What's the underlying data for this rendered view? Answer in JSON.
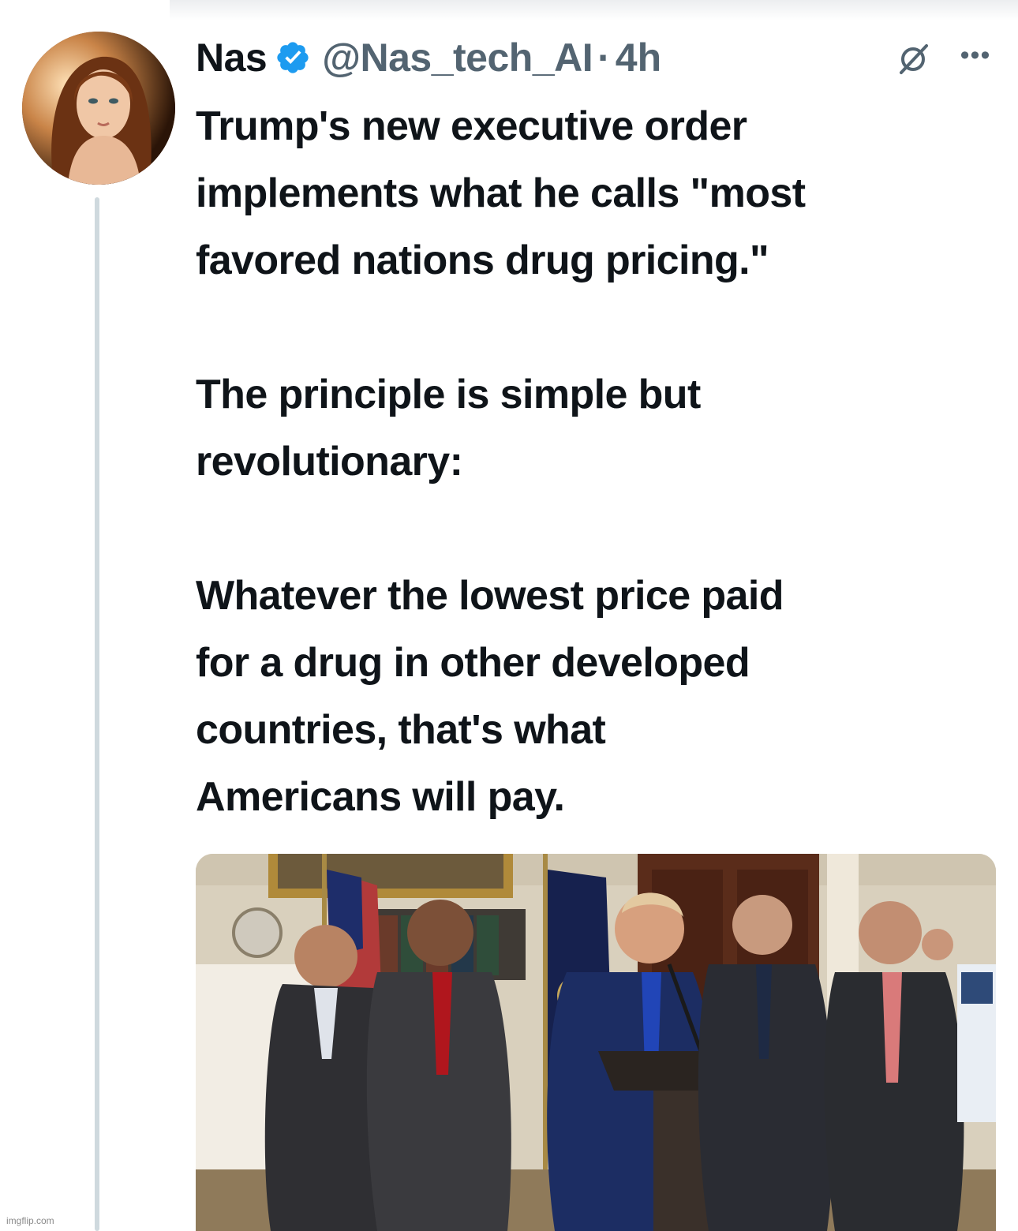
{
  "tweet": {
    "display_name": "Nas",
    "handle": "@Nas_tech_AI",
    "separator": "·",
    "timestamp": "4h",
    "verified": true,
    "paragraphs": [
      [
        "Trump's new executive order",
        "implements what he calls \"most",
        "favored nations drug pricing.\""
      ],
      [
        "The principle is simple but",
        "revolutionary:"
      ],
      [
        "Whatever the lowest price paid",
        "for a drug in other developed",
        "countries, that's what",
        "Americans will pay."
      ]
    ]
  },
  "icons": {
    "verified": "verified-badge-icon",
    "grok": "grok-icon",
    "more": "more-options-icon"
  },
  "colors": {
    "text_primary": "#0f1419",
    "text_secondary": "#536471",
    "verified_blue": "#1d9bf0",
    "thread_line": "#cfd9de"
  },
  "watermark": "imgflip.com"
}
